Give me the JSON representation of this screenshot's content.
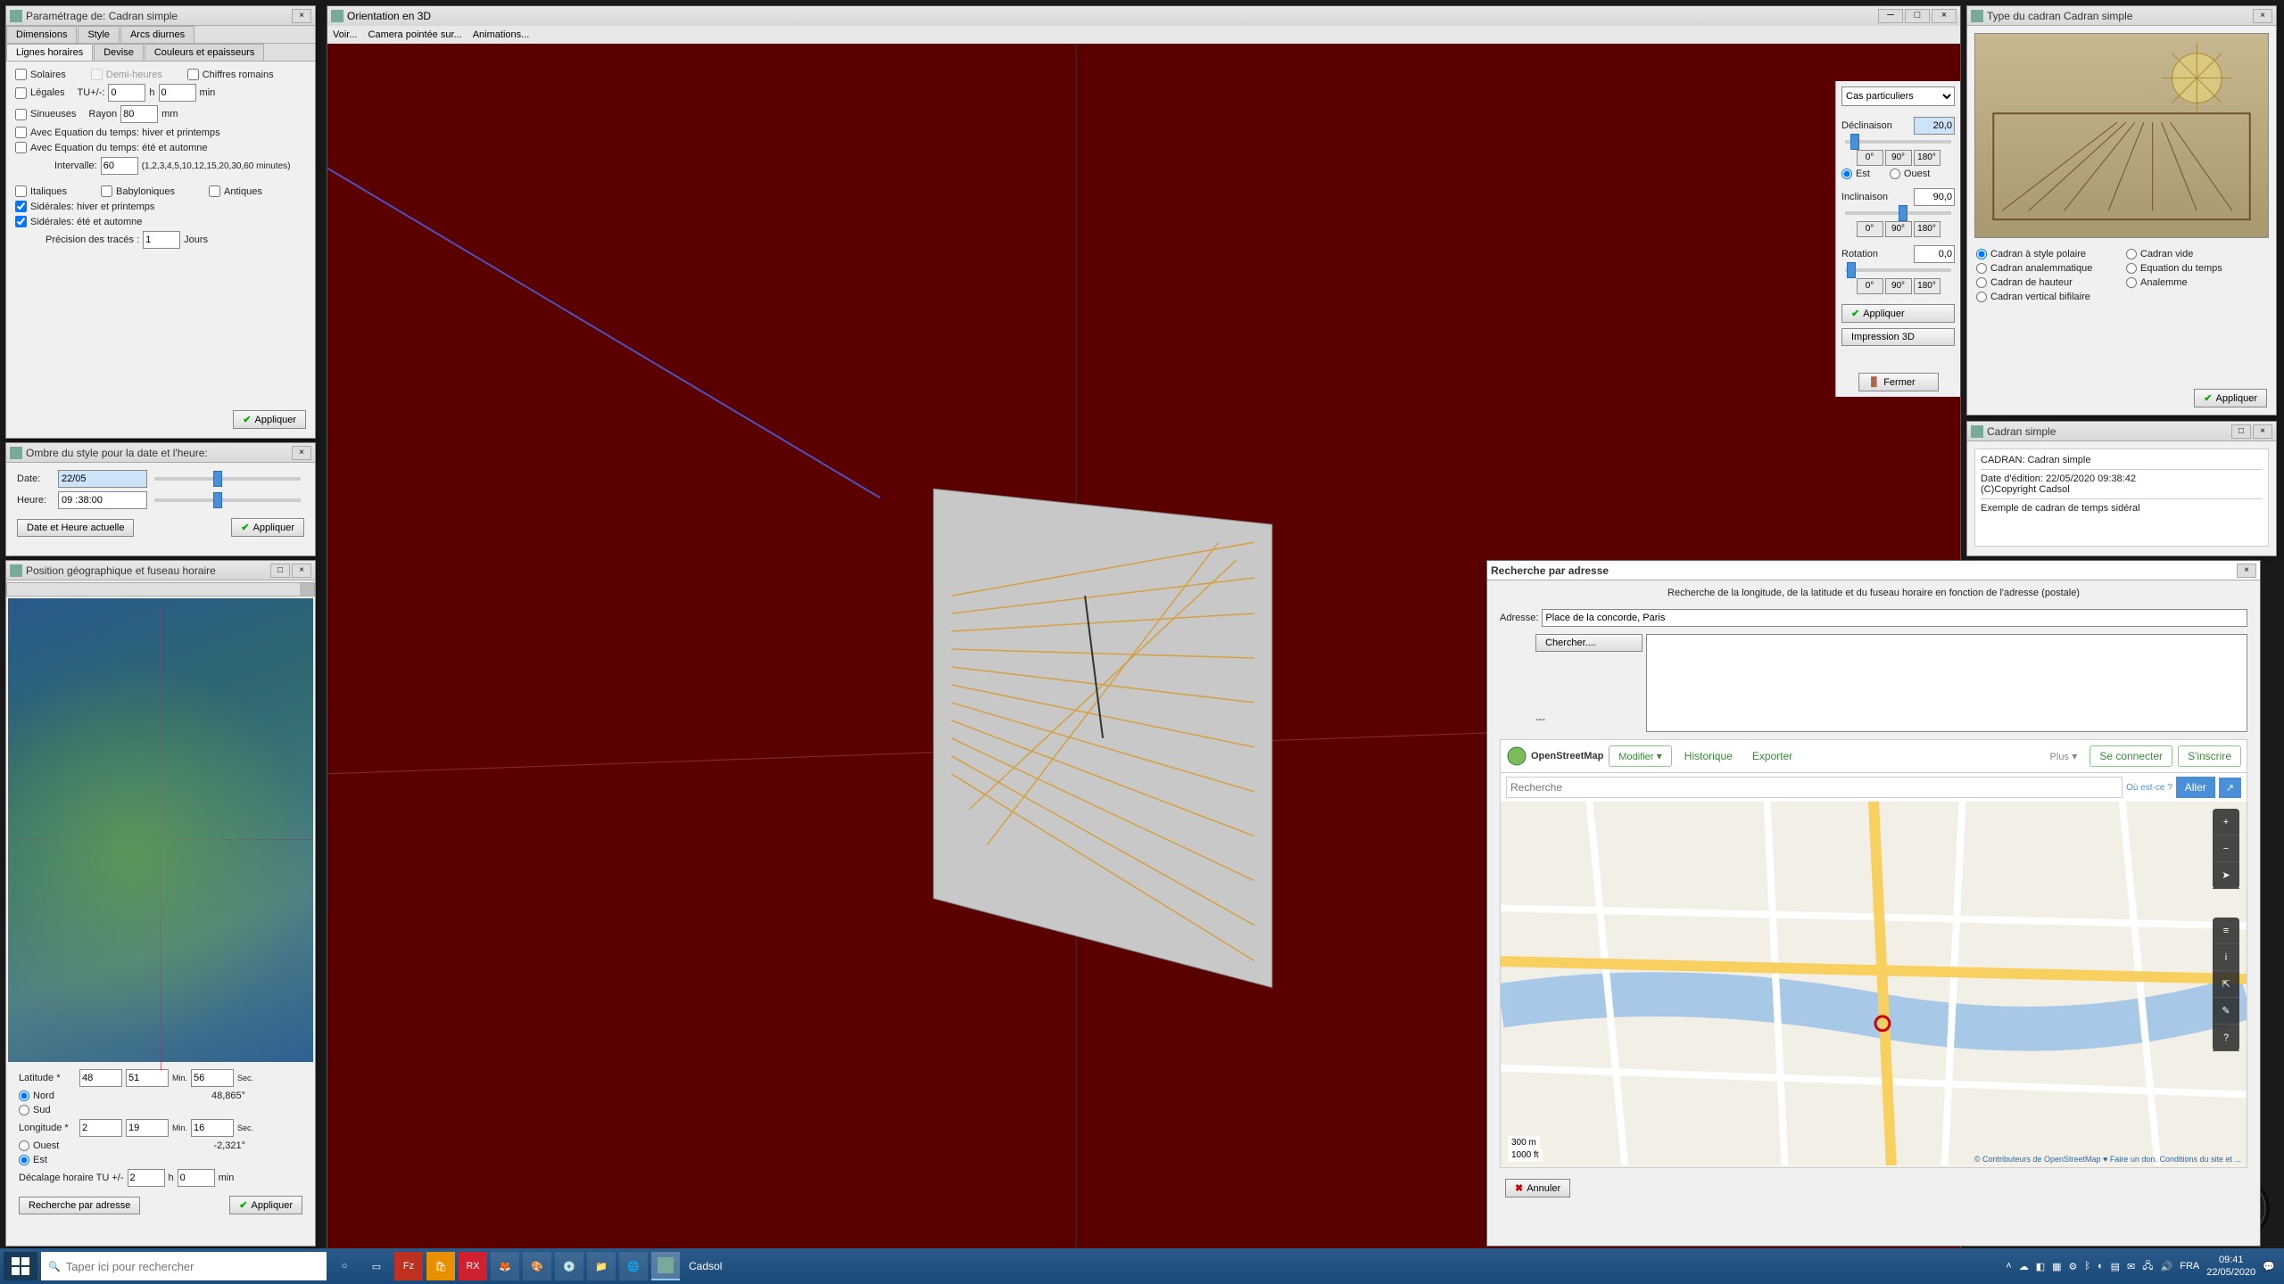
{
  "param_panel": {
    "title": "Paramétrage de: Cadran simple",
    "tabs_top": [
      "Dimensions",
      "Style",
      "Arcs diurnes"
    ],
    "tabs_bot": [
      "Lignes horaires",
      "Devise",
      "Couleurs et epaisseurs"
    ],
    "solar": "Solaires",
    "halfhours": "Demi-heures",
    "roman": "Chiffres romains",
    "legal": "Légales",
    "tu": "TU+/-:",
    "tu_val": "0",
    "tu_unit": "h",
    "tu_min": "0",
    "tu_min_unit": "min",
    "sinuous": "Sinueuses",
    "rayon": "Rayon",
    "rayon_val": "80",
    "rayon_unit": "mm",
    "eot1": "Avec Equation du temps: hiver et printemps",
    "eot2": "Avec Equation du temps: été et automne",
    "interval": "Intervalle:",
    "interval_val": "60",
    "interval_hint": "(1,2,3,4,5,10,12,15,20,30,60 minutes)",
    "italic": "Italiques",
    "babylon": "Babyloniques",
    "antique": "Antiques",
    "sid1": "Sidérales: hiver et printemps",
    "sid2": "Sidérales: été et automne",
    "precision": "Précision des tracés :",
    "precision_val": "1",
    "precision_unit": "Jours",
    "apply": "Appliquer"
  },
  "shadow_panel": {
    "title": "Ombre du style pour la date et l'heure:",
    "date": "Date:",
    "date_val": "22/05",
    "hour": "Heure:",
    "hour_val": "09 :38:00",
    "now": "Date et Heure actuelle",
    "apply": "Appliquer"
  },
  "geo_panel": {
    "title": "Position géographique et fuseau horaire",
    "lat": "Latitude *",
    "lat_deg": "48",
    "lat_min": "51",
    "lat_sec": "56",
    "north": "Nord",
    "south": "Sud",
    "lat_dec": "48,865°",
    "lon": "Longitude *",
    "lon_deg": "2",
    "lon_min": "19",
    "lon_sec": "16",
    "west": "Ouest",
    "east": "Est",
    "lon_dec": "-2,321°",
    "offset": "Décalage horaire TU +/-",
    "off_h": "2",
    "off_h_u": "h",
    "off_m": "0",
    "off_m_u": "min",
    "search_btn": "Recherche par adresse",
    "apply": "Appliquer",
    "min_lbl": "Min.",
    "sec_lbl": "Sec."
  },
  "viewport": {
    "title": "Orientation en 3D",
    "menu": [
      "Voir...",
      "Camera pointée sur...",
      "Animations..."
    ]
  },
  "orient": {
    "type_sel": "Cas particuliers",
    "decl": "Déclinaison",
    "decl_val": "20,0",
    "incl": "Inclinaison",
    "incl_val": "90,0",
    "rot": "Rotation",
    "rot_val": "0,0",
    "east": "Est",
    "west": "Ouest",
    "b0": "0°",
    "b90": "90°",
    "b180": "180°",
    "apply": "Appliquer",
    "print3d": "Impression 3D",
    "close": "Fermer"
  },
  "type_panel": {
    "title": "Type du cadran Cadran simple",
    "r1": "Cadran à style polaire",
    "r2": "Cadran vide",
    "r3": "Cadran analemmatique",
    "r4": "Equation du temps",
    "r5": "Cadran de hauteur",
    "r6": "Analemme",
    "r7": "Cadran vertical bifilaire",
    "apply": "Appliquer"
  },
  "info_panel": {
    "title": "Cadran simple",
    "l1": "CADRAN: Cadran simple",
    "l2": "Date d'édition: 22/05/2020 09:38:42",
    "l3": "(C)Copyright Cadsol",
    "l4": "Exemple de cadran de temps sidéral"
  },
  "search_dlg": {
    "title": "Recherche par adresse",
    "desc": "Recherche de la longitude, de la latitude et du fuseau horaire en fonction de l'adresse (postale)",
    "addr": "Adresse:",
    "addr_val": "Place de la concorde, Paris",
    "go": "Chercher....",
    "dash": "---",
    "osm": "OpenStreetMap",
    "modify": "Modifier",
    "history": "Historique",
    "export": "Exporter",
    "more": "Plus",
    "login": "Se connecter",
    "signup": "S'inscrire",
    "search": "Recherche",
    "where": "Où est-ce ?",
    "aller": "Aller",
    "scale1": "300 m",
    "scale2": "1000 ft",
    "attrib": "© Contributeurs de OpenStreetMap ♥ Faire un don. Conditions du site et ...",
    "cancel": "Annuler"
  },
  "taskbar": {
    "search_ph": "Taper ici pour rechercher",
    "app": "Cadsol",
    "lang": "FRA",
    "time": "09:41",
    "date": "22/05/2020"
  }
}
